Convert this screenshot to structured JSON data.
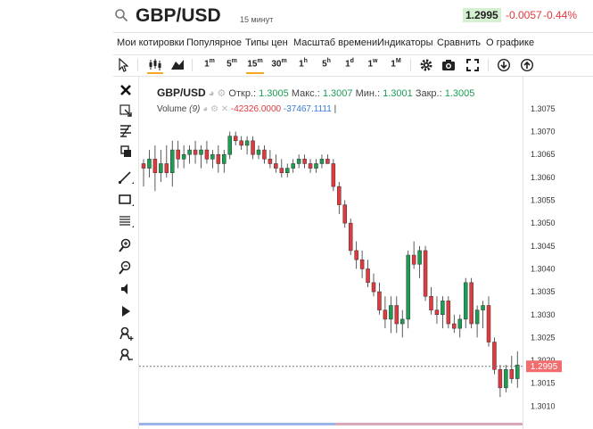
{
  "header": {
    "symbol": "GBP/USD",
    "interval": "15 минут",
    "price": "1.2995",
    "change": "-0.0057",
    "change_percent": "-0.44%"
  },
  "menu": [
    "Мои котировки",
    "Популярное",
    "Типы цен",
    "Масштаб времени",
    "Индикаторы",
    "Сравнить",
    "О графике"
  ],
  "toolbar": {
    "cursor_icon": "cursor-icon",
    "chart_type_icons": [
      "candles-icon",
      "area-icon"
    ],
    "timeframes": [
      {
        "base": "1",
        "sup": "m"
      },
      {
        "base": "5",
        "sup": "m"
      },
      {
        "base": "15",
        "sup": "m"
      },
      {
        "base": "30",
        "sup": "m"
      },
      {
        "base": "1",
        "sup": "h"
      },
      {
        "base": "5",
        "sup": "h"
      },
      {
        "base": "1",
        "sup": "d"
      },
      {
        "base": "1",
        "sup": "w"
      },
      {
        "base": "1",
        "sup": "M"
      }
    ],
    "active_timeframe": "15m",
    "action_icons": [
      "gear-icon",
      "camera-icon",
      "fullscreen-icon",
      "download-icon",
      "upload-icon"
    ]
  },
  "sidebar_tools": [
    "close-icon",
    "crosshair-icon",
    "fibonacci-icon",
    "copy-icon",
    "trendline-icon",
    "rectangle-icon",
    "text-lines-icon",
    "zoom-in-icon",
    "zoom-out-icon",
    "speaker-icon",
    "sound-right-icon",
    "magnet-plus-icon",
    "magnet-icon"
  ],
  "legend": {
    "symbol": "GBP/USD",
    "open_label": "Откр.:",
    "open": "1.3005",
    "high_label": "Макс.:",
    "high": "1.3007",
    "low_label": "Мин.:",
    "low": "1.3001",
    "close_label": "Закр.:",
    "close": "1.3005",
    "volume_label": "Volume",
    "volume_period": "(9)",
    "volume_value1": "-42326.0000",
    "volume_value2": "-37467.1111",
    "cursor_mark": "|"
  },
  "colors": {
    "up": "#1b9e52",
    "down": "#e0393e",
    "accent": "#f5a623",
    "price_tag": "#f26d6d"
  },
  "chart_data": {
    "type": "candlestick",
    "ylim": [
      1.3005,
      1.3082
    ],
    "y_ticks": [
      "1.3075",
      "1.3070",
      "1.3065",
      "1.3060",
      "1.3055",
      "1.3050",
      "1.3045",
      "1.3040",
      "1.3035",
      "1.3030",
      "1.3025",
      "1.3020",
      "1.3015",
      "1.3010"
    ],
    "last_price": "1.2995",
    "candles": [
      [
        1.3063,
        1.3064,
        1.3058,
        1.3062
      ],
      [
        1.3062,
        1.3066,
        1.306,
        1.3064
      ],
      [
        1.3064,
        1.3067,
        1.3057,
        1.3061
      ],
      [
        1.3061,
        1.3066,
        1.3059,
        1.3063
      ],
      [
        1.3063,
        1.3067,
        1.306,
        1.3061
      ],
      [
        1.3061,
        1.3068,
        1.3058,
        1.3066
      ],
      [
        1.3066,
        1.3068,
        1.3062,
        1.3064
      ],
      [
        1.3064,
        1.3067,
        1.3062,
        1.3065
      ],
      [
        1.3065,
        1.3067,
        1.3063,
        1.3066
      ],
      [
        1.3066,
        1.3068,
        1.3063,
        1.3065
      ],
      [
        1.3065,
        1.3067,
        1.3062,
        1.3066
      ],
      [
        1.3066,
        1.3068,
        1.3063,
        1.3064
      ],
      [
        1.3064,
        1.3066,
        1.3062,
        1.3065
      ],
      [
        1.3065,
        1.3067,
        1.3061,
        1.3063
      ],
      [
        1.3063,
        1.3066,
        1.3061,
        1.3065
      ],
      [
        1.3065,
        1.307,
        1.3064,
        1.3069
      ],
      [
        1.3069,
        1.307,
        1.3067,
        1.3068
      ],
      [
        1.3068,
        1.3069,
        1.3066,
        1.3067
      ],
      [
        1.3067,
        1.3069,
        1.3065,
        1.3068
      ],
      [
        1.3068,
        1.3069,
        1.3064,
        1.3065
      ],
      [
        1.3065,
        1.3067,
        1.3064,
        1.3066
      ],
      [
        1.3066,
        1.3067,
        1.3063,
        1.3064
      ],
      [
        1.3064,
        1.3066,
        1.3062,
        1.3063
      ],
      [
        1.3063,
        1.3065,
        1.3061,
        1.3062
      ],
      [
        1.3062,
        1.3064,
        1.306,
        1.3061
      ],
      [
        1.3061,
        1.3063,
        1.306,
        1.3062
      ],
      [
        1.3062,
        1.3064,
        1.3061,
        1.3063
      ],
      [
        1.3063,
        1.3065,
        1.3062,
        1.3064
      ],
      [
        1.3064,
        1.3065,
        1.3062,
        1.3063
      ],
      [
        1.3063,
        1.3064,
        1.3061,
        1.3062
      ],
      [
        1.3062,
        1.3064,
        1.3061,
        1.3063
      ],
      [
        1.3063,
        1.3065,
        1.3062,
        1.3064
      ],
      [
        1.3064,
        1.3065,
        1.3063,
        1.3063
      ],
      [
        1.3063,
        1.3064,
        1.3057,
        1.3058
      ],
      [
        1.3058,
        1.3059,
        1.3052,
        1.3054
      ],
      [
        1.3054,
        1.3055,
        1.3049,
        1.305
      ],
      [
        1.305,
        1.3051,
        1.3043,
        1.3044
      ],
      [
        1.3044,
        1.3046,
        1.304,
        1.3042
      ],
      [
        1.3042,
        1.3044,
        1.3038,
        1.304
      ],
      [
        1.304,
        1.3042,
        1.3036,
        1.3037
      ],
      [
        1.3037,
        1.3039,
        1.3034,
        1.3035
      ],
      [
        1.3035,
        1.3037,
        1.303,
        1.3031
      ],
      [
        1.3031,
        1.3034,
        1.3027,
        1.3029
      ],
      [
        1.3029,
        1.3034,
        1.3026,
        1.3032
      ],
      [
        1.3032,
        1.3034,
        1.3026,
        1.3028
      ],
      [
        1.3028,
        1.3031,
        1.3025,
        1.3029
      ],
      [
        1.3029,
        1.3044,
        1.3027,
        1.3043
      ],
      [
        1.3043,
        1.3046,
        1.304,
        1.3041
      ],
      [
        1.3041,
        1.3045,
        1.3038,
        1.3044
      ],
      [
        1.3044,
        1.3045,
        1.3033,
        1.3034
      ],
      [
        1.3034,
        1.3036,
        1.303,
        1.3031
      ],
      [
        1.3031,
        1.3034,
        1.3028,
        1.303
      ],
      [
        1.303,
        1.3034,
        1.3027,
        1.3033
      ],
      [
        1.3033,
        1.3034,
        1.3027,
        1.3028
      ],
      [
        1.3028,
        1.303,
        1.3026,
        1.3027
      ],
      [
        1.3027,
        1.303,
        1.3025,
        1.3029
      ],
      [
        1.3029,
        1.3038,
        1.3027,
        1.3037
      ],
      [
        1.3037,
        1.3038,
        1.3027,
        1.3028
      ],
      [
        1.3028,
        1.3032,
        1.3025,
        1.3031
      ],
      [
        1.3031,
        1.3033,
        1.3027,
        1.3032
      ],
      [
        1.3032,
        1.3034,
        1.3023,
        1.3024
      ],
      [
        1.3024,
        1.3025,
        1.3017,
        1.3018
      ],
      [
        1.3018,
        1.3019,
        1.3012,
        1.3014
      ],
      [
        1.3014,
        1.3019,
        1.3013,
        1.3018
      ],
      [
        1.3018,
        1.3021,
        1.3015,
        1.3016
      ],
      [
        1.3016,
        1.3022,
        1.3014,
        1.3019
      ]
    ]
  }
}
